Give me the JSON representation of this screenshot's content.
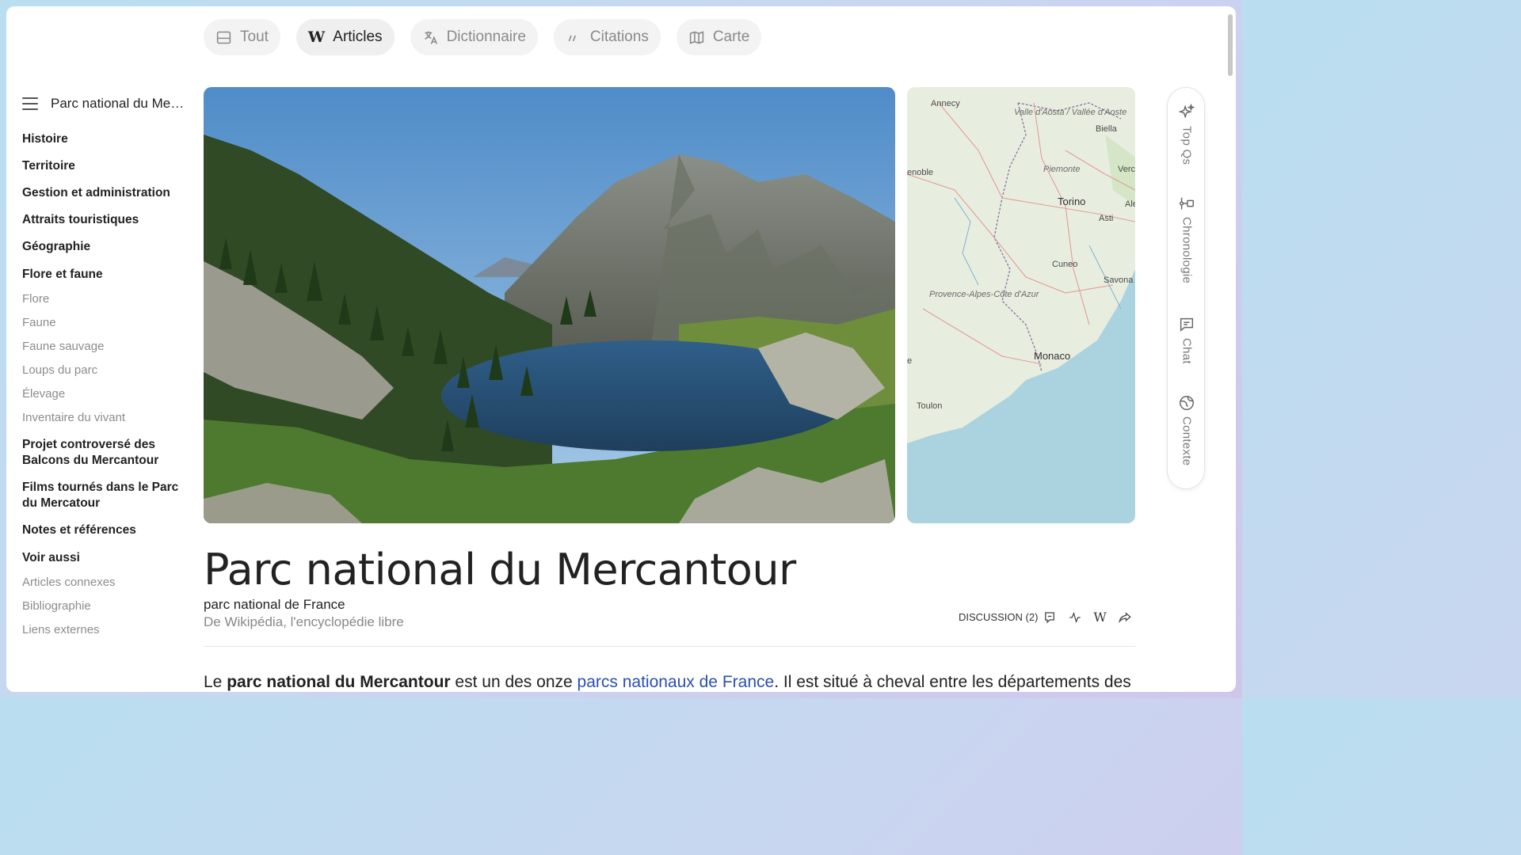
{
  "tabs": [
    {
      "label": "Tout",
      "icon": "layout-icon"
    },
    {
      "label": "Articles",
      "icon": "wikipedia-icon"
    },
    {
      "label": "Dictionnaire",
      "icon": "translate-icon"
    },
    {
      "label": "Citations",
      "icon": "quote-icon"
    },
    {
      "label": "Carte",
      "icon": "map-icon"
    }
  ],
  "sidebar": {
    "title": "Parc national du Mercantour",
    "items": [
      {
        "label": "Histoire",
        "level": 1
      },
      {
        "label": "Territoire",
        "level": 1
      },
      {
        "label": "Gestion et administration",
        "level": 1
      },
      {
        "label": "Attraits touristiques",
        "level": 1
      },
      {
        "label": "Géographie",
        "level": 1
      },
      {
        "label": "Flore et faune",
        "level": 1
      },
      {
        "label": "Flore",
        "level": 2
      },
      {
        "label": "Faune",
        "level": 2
      },
      {
        "label": "Faune sauvage",
        "level": 2
      },
      {
        "label": "Loups du parc",
        "level": 2
      },
      {
        "label": "Élevage",
        "level": 2
      },
      {
        "label": "Inventaire du vivant",
        "level": 2
      },
      {
        "label": "Projet controversé des Balcons du Mercantour",
        "level": 1
      },
      {
        "label": "Films tournés dans le Parc du Mercatour",
        "level": 1
      },
      {
        "label": "Notes et références",
        "level": 1
      },
      {
        "label": "Voir aussi",
        "level": 1
      },
      {
        "label": "Articles connexes",
        "level": 2
      },
      {
        "label": "Bibliographie",
        "level": 2
      },
      {
        "label": "Liens externes",
        "level": 2
      }
    ]
  },
  "map": {
    "labels": {
      "annecy": "Annecy",
      "aosta": "Valle d'Aosta / Vallée d'Aoste",
      "biella": "Biella",
      "grenoble": "enoble",
      "piemonte": "Piemonte",
      "verc": "Verc",
      "torino": "Torino",
      "ale": "Ale",
      "asti": "Asti",
      "cuneo": "Cuneo",
      "savona": "Savona",
      "provence": "Provence-Alpes-Côte d'Azur",
      "monaco": "Monaco",
      "toulon": "Toulon",
      "e": "e"
    }
  },
  "rail": [
    {
      "label": "Top Qs",
      "icon": "sparkle-icon"
    },
    {
      "label": "Chronologie",
      "icon": "timeline-icon"
    },
    {
      "label": "Chat",
      "icon": "chat-icon"
    },
    {
      "label": "Contexte",
      "icon": "globe-icon"
    }
  ],
  "article": {
    "title": "Parc national du Mercantour",
    "subtitle": "parc national de France",
    "source": "De Wikipédia, l'encyclopédie libre",
    "discussion_label": "DISCUSSION (2)",
    "body": {
      "prefix": "Le ",
      "bold": "parc national du Mercantour",
      "middle": " est un des onze ",
      "link": "parcs nationaux de France",
      "suffix": ". Il est situé à cheval entre les départements des"
    }
  },
  "colors": {
    "accent_link": "#2a4fb0",
    "water": "#aad3df",
    "land": "#e8eedf"
  }
}
